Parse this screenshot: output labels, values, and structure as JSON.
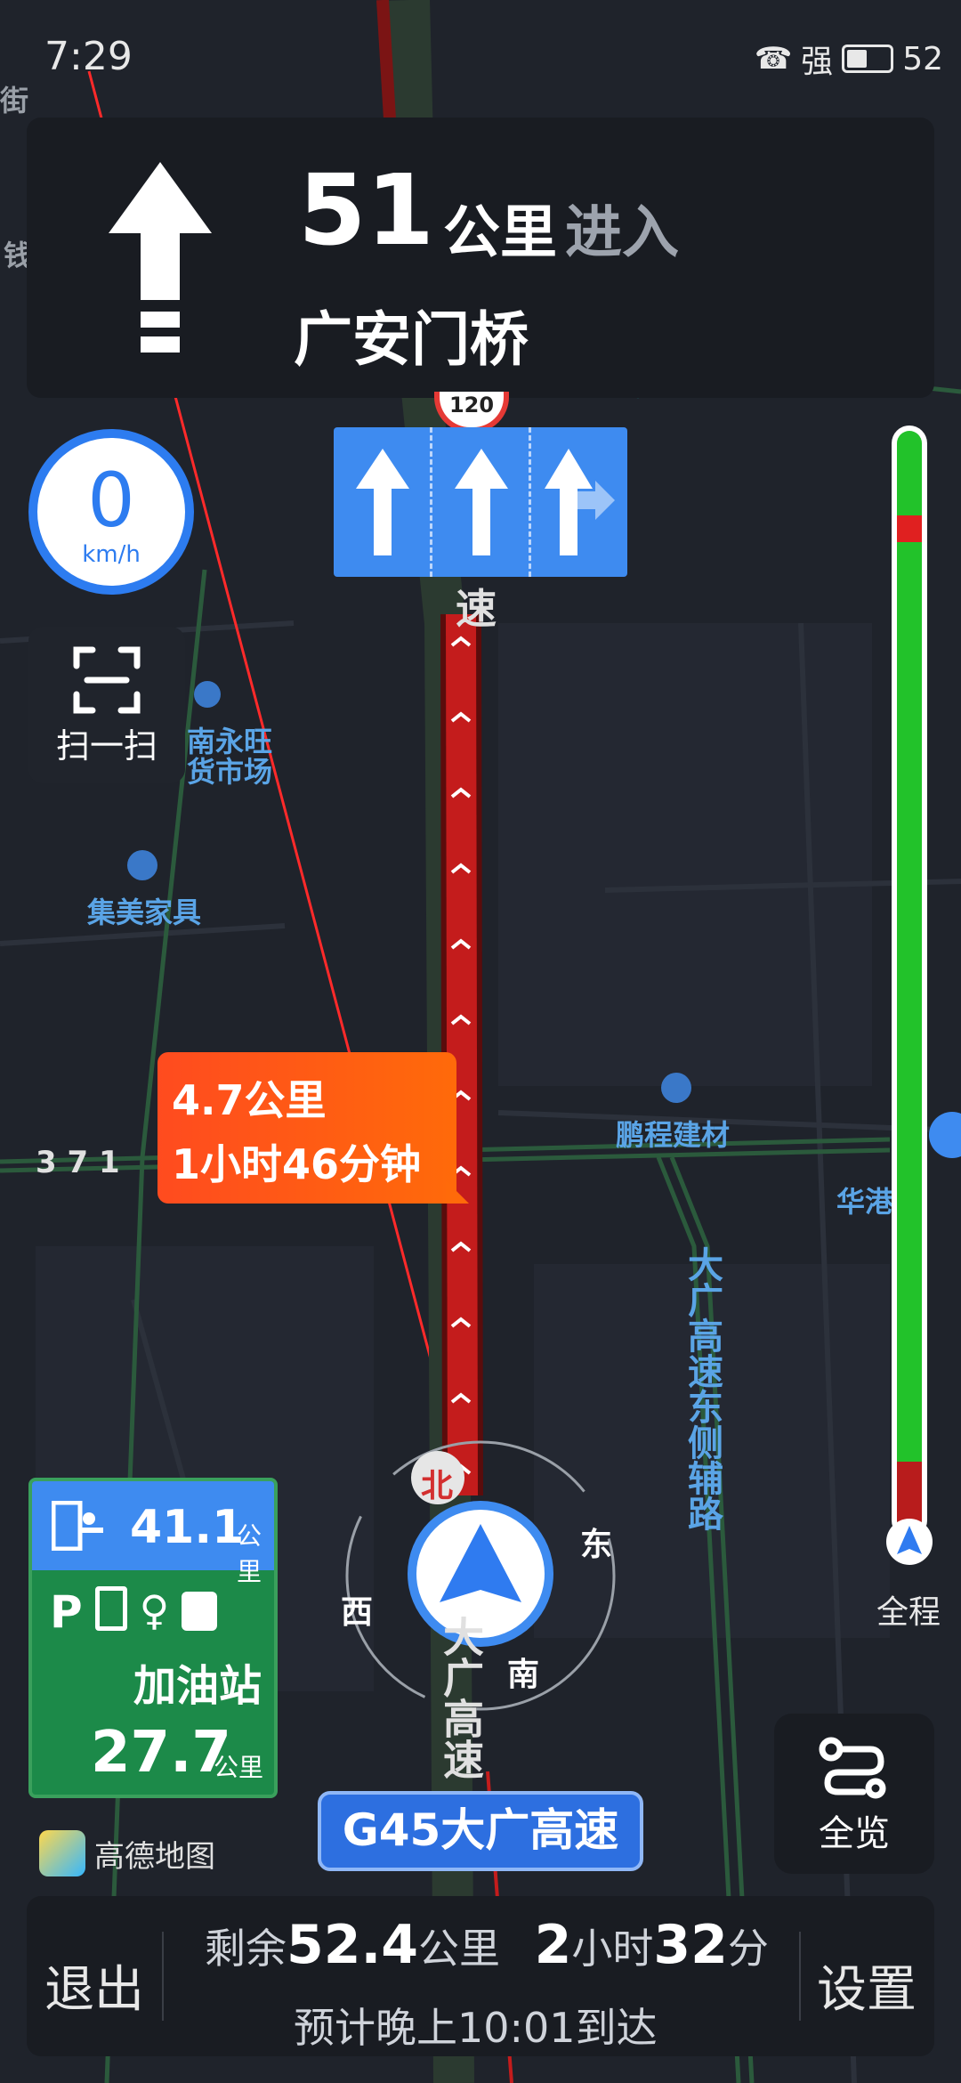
{
  "status": {
    "time": "7:29",
    "signal": "强",
    "battery": "52"
  },
  "guidance": {
    "distance": "51",
    "unit": "公里",
    "action": "进入",
    "road": "广安门桥"
  },
  "speed": {
    "value": "0",
    "unit": "km/h"
  },
  "speed_limit": "120",
  "scan": {
    "label": "扫一扫"
  },
  "callout": {
    "distance": "4.7公里",
    "time": "1小时46分钟"
  },
  "service": {
    "distance": "41.1",
    "unit": "公里",
    "name": "加油站",
    "name_distance": "27.7",
    "name_unit": "公里"
  },
  "progress": {
    "full_label": "全程"
  },
  "logo": {
    "name": "高德地图"
  },
  "road_name": "G45大广高速",
  "overview": {
    "label": "全览"
  },
  "bottom": {
    "exit": "退出",
    "settings": "设置",
    "remaining_prefix": "剩余",
    "remaining_distance": "52.4",
    "remaining_distance_unit": "公里",
    "remaining_hours": "2",
    "remaining_hours_unit": "小时",
    "remaining_minutes": "32",
    "remaining_minutes_unit": "分",
    "eta": "预计晚上10:01到达"
  },
  "compass": {
    "north": "北",
    "east": "东",
    "south": "南",
    "west": "西"
  },
  "map_labels": {
    "poi1_line1": "南永旺",
    "poi1_line2": "货市场",
    "poi2": "集美家具",
    "poi3": "鹏程建材",
    "poi4": "华港",
    "road_east": "大广高速东侧辅路",
    "road_main": "大广高速",
    "road_main_top": "速",
    "road_371": "3 7 1",
    "edge_top_left": "街",
    "edge_left": "钱"
  },
  "colors": {
    "accent": "#3e8bf0",
    "route_jam": "#c41c1c",
    "route_clear": "#22c22a",
    "callout": "#ff5a14"
  }
}
